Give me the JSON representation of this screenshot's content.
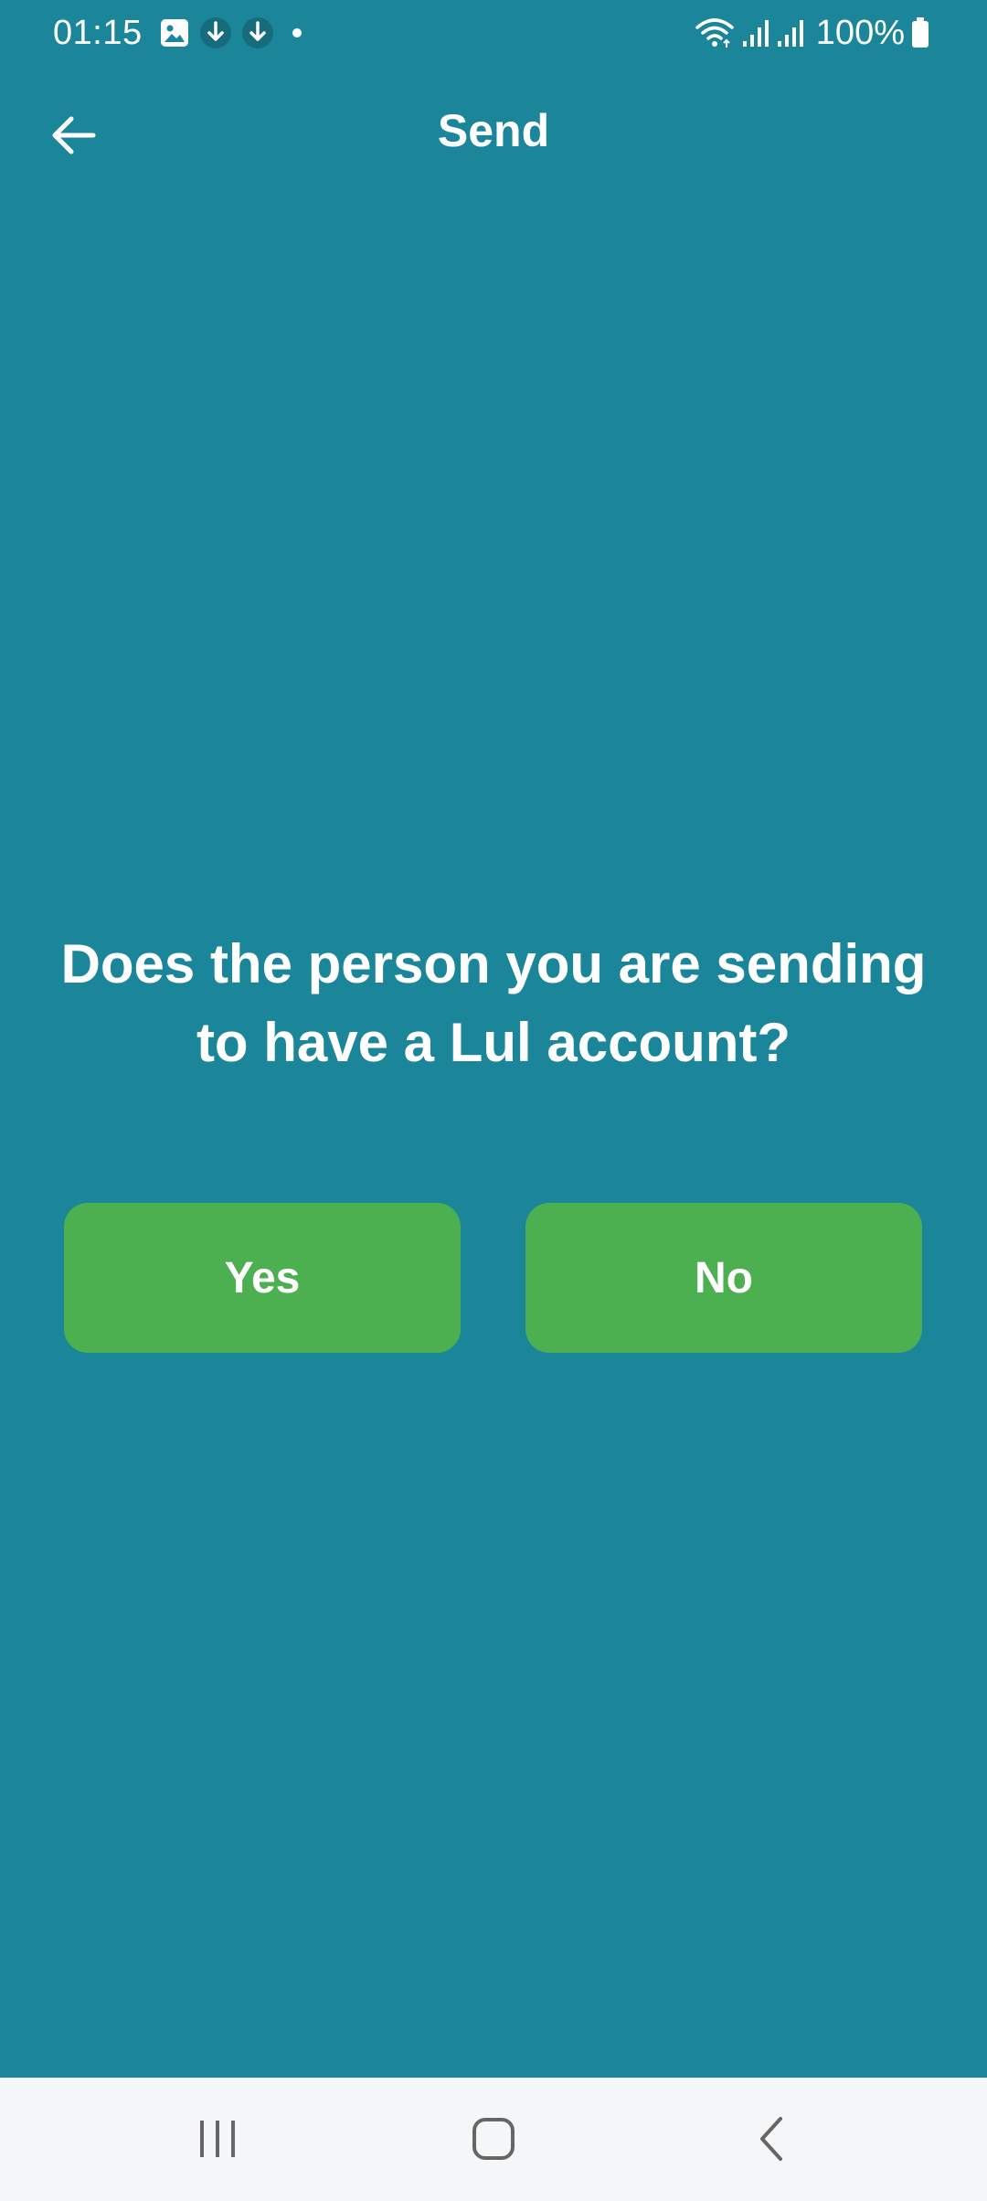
{
  "status_bar": {
    "time": "01:15",
    "battery": "100%",
    "left_icons": [
      "gallery-icon",
      "download-icon",
      "download-icon",
      "notification-dot-icon"
    ],
    "right_icons": [
      "wifi-icon",
      "signal-icon",
      "signal-icon",
      "battery-icon"
    ]
  },
  "app_bar": {
    "title": "Send",
    "back_icon": "arrow-left-icon"
  },
  "main": {
    "question": "Does the person you are sending to have a Lul account?",
    "yes_label": "Yes",
    "no_label": "No"
  },
  "nav_bar": {
    "icons": [
      "recents-icon",
      "home-icon",
      "back-icon"
    ]
  },
  "colors": {
    "background": "#1b8699",
    "button": "#4caf50",
    "nav_bar": "#f5f6f7",
    "text": "#ffffff"
  }
}
